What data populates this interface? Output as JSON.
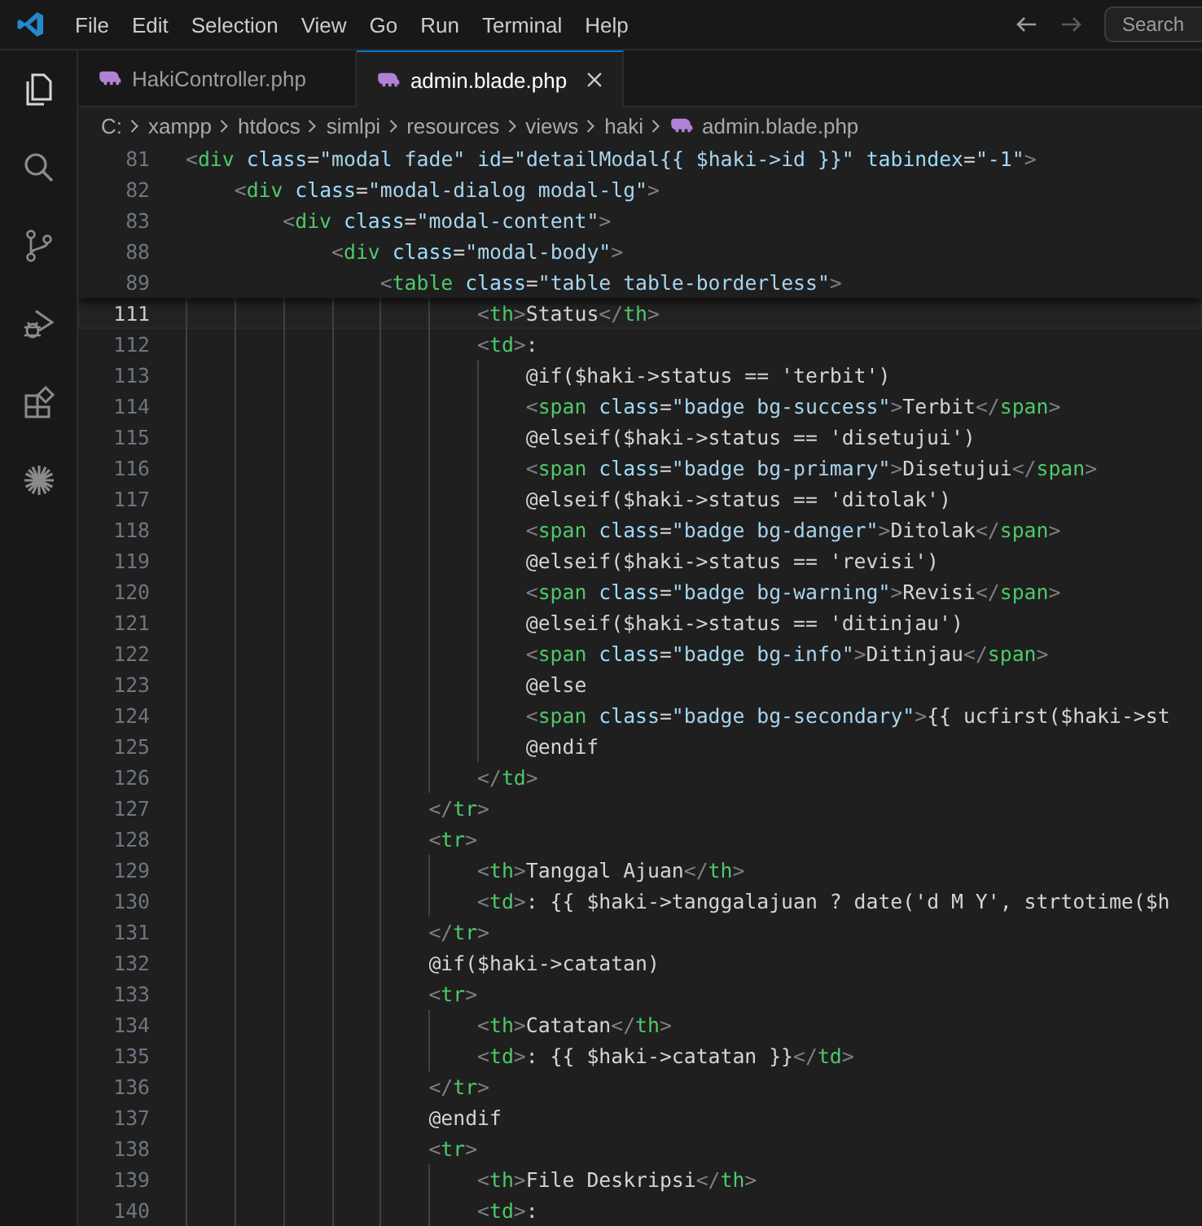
{
  "menu": [
    "File",
    "Edit",
    "Selection",
    "View",
    "Go",
    "Run",
    "Terminal",
    "Help"
  ],
  "search": {
    "placeholder": "Search"
  },
  "activity_bar": [
    {
      "kind": "explorer",
      "selected": true
    },
    {
      "kind": "search",
      "selected": false
    },
    {
      "kind": "source-control",
      "selected": false
    },
    {
      "kind": "run-debug",
      "selected": false
    },
    {
      "kind": "extensions",
      "selected": false
    },
    {
      "kind": "burst",
      "selected": false
    }
  ],
  "tabs": [
    {
      "label": "HakiController.php",
      "selected": false
    },
    {
      "label": "admin.blade.php",
      "selected": true
    }
  ],
  "breadcrumb": [
    "C:",
    "xampp",
    "htdocs",
    "simlpi",
    "resources",
    "views",
    "haki",
    "admin.blade.php"
  ],
  "sticky_lines": [
    {
      "number": "81",
      "tokens": [
        {
          "kind": "punct",
          "text": "<"
        },
        {
          "kind": "tag",
          "text": "div"
        },
        {
          "kind": "attr",
          "text": " class"
        },
        {
          "kind": "plain",
          "text": "="
        },
        {
          "kind": "string",
          "text": "\"modal fade\""
        },
        {
          "kind": "attr",
          "text": " id"
        },
        {
          "kind": "plain",
          "text": "="
        },
        {
          "kind": "string",
          "text": "\"detailModal{{ $haki->id }}\""
        },
        {
          "kind": "attr",
          "text": " tabindex"
        },
        {
          "kind": "plain",
          "text": "="
        },
        {
          "kind": "string",
          "text": "\"-1\""
        },
        {
          "kind": "punct",
          "text": ">"
        }
      ]
    },
    {
      "number": "82",
      "tokens": [
        {
          "kind": "punct",
          "text": "    <"
        },
        {
          "kind": "tag",
          "text": "div"
        },
        {
          "kind": "attr",
          "text": " class"
        },
        {
          "kind": "plain",
          "text": "="
        },
        {
          "kind": "string",
          "text": "\"modal-dialog modal-lg\""
        },
        {
          "kind": "punct",
          "text": ">"
        }
      ]
    },
    {
      "number": "83",
      "tokens": [
        {
          "kind": "punct",
          "text": "        <"
        },
        {
          "kind": "tag",
          "text": "div"
        },
        {
          "kind": "attr",
          "text": " class"
        },
        {
          "kind": "plain",
          "text": "="
        },
        {
          "kind": "string",
          "text": "\"modal-content\""
        },
        {
          "kind": "punct",
          "text": ">"
        }
      ]
    },
    {
      "number": "88",
      "tokens": [
        {
          "kind": "punct",
          "text": "            <"
        },
        {
          "kind": "tag",
          "text": "div"
        },
        {
          "kind": "attr",
          "text": " class"
        },
        {
          "kind": "plain",
          "text": "="
        },
        {
          "kind": "string",
          "text": "\"modal-body\""
        },
        {
          "kind": "punct",
          "text": ">"
        }
      ]
    },
    {
      "number": "89",
      "tokens": [
        {
          "kind": "punct",
          "text": "                <"
        },
        {
          "kind": "tag",
          "text": "table"
        },
        {
          "kind": "attr",
          "text": " class"
        },
        {
          "kind": "plain",
          "text": "="
        },
        {
          "kind": "string",
          "text": "\"table table-borderless\""
        },
        {
          "kind": "punct",
          "text": ">"
        }
      ]
    }
  ],
  "lines": [
    {
      "number": "111",
      "selected": true,
      "tokens": [
        {
          "kind": "punct",
          "text": "                        <"
        },
        {
          "kind": "tag",
          "text": "th"
        },
        {
          "kind": "punct",
          "text": ">"
        },
        {
          "kind": "plain",
          "text": "Status"
        },
        {
          "kind": "punct",
          "text": "</"
        },
        {
          "kind": "tag",
          "text": "th"
        },
        {
          "kind": "punct",
          "text": ">"
        }
      ]
    },
    {
      "number": "112",
      "selected": false,
      "tokens": [
        {
          "kind": "punct",
          "text": "                        <"
        },
        {
          "kind": "tag",
          "text": "td"
        },
        {
          "kind": "punct",
          "text": ">"
        },
        {
          "kind": "plain",
          "text": ":"
        }
      ]
    },
    {
      "number": "113",
      "selected": false,
      "tokens": [
        {
          "kind": "plain",
          "text": "                            @if($haki->status == 'terbit')"
        }
      ]
    },
    {
      "number": "114",
      "selected": false,
      "tokens": [
        {
          "kind": "punct",
          "text": "                            <"
        },
        {
          "kind": "tag",
          "text": "span"
        },
        {
          "kind": "attr",
          "text": " class"
        },
        {
          "kind": "plain",
          "text": "="
        },
        {
          "kind": "string",
          "text": "\"badge bg-success\""
        },
        {
          "kind": "punct",
          "text": ">"
        },
        {
          "kind": "plain",
          "text": "Terbit"
        },
        {
          "kind": "punct",
          "text": "</"
        },
        {
          "kind": "tag",
          "text": "span"
        },
        {
          "kind": "punct",
          "text": ">"
        }
      ]
    },
    {
      "number": "115",
      "selected": false,
      "tokens": [
        {
          "kind": "plain",
          "text": "                            @elseif($haki->status == 'disetujui')"
        }
      ]
    },
    {
      "number": "116",
      "selected": false,
      "tokens": [
        {
          "kind": "punct",
          "text": "                            <"
        },
        {
          "kind": "tag",
          "text": "span"
        },
        {
          "kind": "attr",
          "text": " class"
        },
        {
          "kind": "plain",
          "text": "="
        },
        {
          "kind": "string",
          "text": "\"badge bg-primary\""
        },
        {
          "kind": "punct",
          "text": ">"
        },
        {
          "kind": "plain",
          "text": "Disetujui"
        },
        {
          "kind": "punct",
          "text": "</"
        },
        {
          "kind": "tag",
          "text": "span"
        },
        {
          "kind": "punct",
          "text": ">"
        }
      ]
    },
    {
      "number": "117",
      "selected": false,
      "tokens": [
        {
          "kind": "plain",
          "text": "                            @elseif($haki->status == 'ditolak')"
        }
      ]
    },
    {
      "number": "118",
      "selected": false,
      "tokens": [
        {
          "kind": "punct",
          "text": "                            <"
        },
        {
          "kind": "tag",
          "text": "span"
        },
        {
          "kind": "attr",
          "text": " class"
        },
        {
          "kind": "plain",
          "text": "="
        },
        {
          "kind": "string",
          "text": "\"badge bg-danger\""
        },
        {
          "kind": "punct",
          "text": ">"
        },
        {
          "kind": "plain",
          "text": "Ditolak"
        },
        {
          "kind": "punct",
          "text": "</"
        },
        {
          "kind": "tag",
          "text": "span"
        },
        {
          "kind": "punct",
          "text": ">"
        }
      ]
    },
    {
      "number": "119",
      "selected": false,
      "tokens": [
        {
          "kind": "plain",
          "text": "                            @elseif($haki->status == 'revisi')"
        }
      ]
    },
    {
      "number": "120",
      "selected": false,
      "tokens": [
        {
          "kind": "punct",
          "text": "                            <"
        },
        {
          "kind": "tag",
          "text": "span"
        },
        {
          "kind": "attr",
          "text": " class"
        },
        {
          "kind": "plain",
          "text": "="
        },
        {
          "kind": "string",
          "text": "\"badge bg-warning\""
        },
        {
          "kind": "punct",
          "text": ">"
        },
        {
          "kind": "plain",
          "text": "Revisi"
        },
        {
          "kind": "punct",
          "text": "</"
        },
        {
          "kind": "tag",
          "text": "span"
        },
        {
          "kind": "punct",
          "text": ">"
        }
      ]
    },
    {
      "number": "121",
      "selected": false,
      "tokens": [
        {
          "kind": "plain",
          "text": "                            @elseif($haki->status == 'ditinjau')"
        }
      ]
    },
    {
      "number": "122",
      "selected": false,
      "tokens": [
        {
          "kind": "punct",
          "text": "                            <"
        },
        {
          "kind": "tag",
          "text": "span"
        },
        {
          "kind": "attr",
          "text": " class"
        },
        {
          "kind": "plain",
          "text": "="
        },
        {
          "kind": "string",
          "text": "\"badge bg-info\""
        },
        {
          "kind": "punct",
          "text": ">"
        },
        {
          "kind": "plain",
          "text": "Ditinjau"
        },
        {
          "kind": "punct",
          "text": "</"
        },
        {
          "kind": "tag",
          "text": "span"
        },
        {
          "kind": "punct",
          "text": ">"
        }
      ]
    },
    {
      "number": "123",
      "selected": false,
      "tokens": [
        {
          "kind": "plain",
          "text": "                            @else"
        }
      ]
    },
    {
      "number": "124",
      "selected": false,
      "tokens": [
        {
          "kind": "punct",
          "text": "                            <"
        },
        {
          "kind": "tag",
          "text": "span"
        },
        {
          "kind": "attr",
          "text": " class"
        },
        {
          "kind": "plain",
          "text": "="
        },
        {
          "kind": "string",
          "text": "\"badge bg-secondary\""
        },
        {
          "kind": "punct",
          "text": ">"
        },
        {
          "kind": "plain",
          "text": "{{ ucfirst($haki->st"
        }
      ]
    },
    {
      "number": "125",
      "selected": false,
      "tokens": [
        {
          "kind": "plain",
          "text": "                            @endif"
        }
      ]
    },
    {
      "number": "126",
      "selected": false,
      "tokens": [
        {
          "kind": "punct",
          "text": "                        </"
        },
        {
          "kind": "tag",
          "text": "td"
        },
        {
          "kind": "punct",
          "text": ">"
        }
      ]
    },
    {
      "number": "127",
      "selected": false,
      "tokens": [
        {
          "kind": "punct",
          "text": "                    </"
        },
        {
          "kind": "tag",
          "text": "tr"
        },
        {
          "kind": "punct",
          "text": ">"
        }
      ]
    },
    {
      "number": "128",
      "selected": false,
      "tokens": [
        {
          "kind": "punct",
          "text": "                    <"
        },
        {
          "kind": "tag",
          "text": "tr"
        },
        {
          "kind": "punct",
          "text": ">"
        }
      ]
    },
    {
      "number": "129",
      "selected": false,
      "tokens": [
        {
          "kind": "punct",
          "text": "                        <"
        },
        {
          "kind": "tag",
          "text": "th"
        },
        {
          "kind": "punct",
          "text": ">"
        },
        {
          "kind": "plain",
          "text": "Tanggal Ajuan"
        },
        {
          "kind": "punct",
          "text": "</"
        },
        {
          "kind": "tag",
          "text": "th"
        },
        {
          "kind": "punct",
          "text": ">"
        }
      ]
    },
    {
      "number": "130",
      "selected": false,
      "tokens": [
        {
          "kind": "punct",
          "text": "                        <"
        },
        {
          "kind": "tag",
          "text": "td"
        },
        {
          "kind": "punct",
          "text": ">"
        },
        {
          "kind": "plain",
          "text": ": {{ $haki->tanggalajuan ? date('d M Y', strtotime($h"
        }
      ]
    },
    {
      "number": "131",
      "selected": false,
      "tokens": [
        {
          "kind": "punct",
          "text": "                    </"
        },
        {
          "kind": "tag",
          "text": "tr"
        },
        {
          "kind": "punct",
          "text": ">"
        }
      ]
    },
    {
      "number": "132",
      "selected": false,
      "tokens": [
        {
          "kind": "plain",
          "text": "                    @if($haki->catatan)"
        }
      ]
    },
    {
      "number": "133",
      "selected": false,
      "tokens": [
        {
          "kind": "punct",
          "text": "                    <"
        },
        {
          "kind": "tag",
          "text": "tr"
        },
        {
          "kind": "punct",
          "text": ">"
        }
      ]
    },
    {
      "number": "134",
      "selected": false,
      "tokens": [
        {
          "kind": "punct",
          "text": "                        <"
        },
        {
          "kind": "tag",
          "text": "th"
        },
        {
          "kind": "punct",
          "text": ">"
        },
        {
          "kind": "plain",
          "text": "Catatan"
        },
        {
          "kind": "punct",
          "text": "</"
        },
        {
          "kind": "tag",
          "text": "th"
        },
        {
          "kind": "punct",
          "text": ">"
        }
      ]
    },
    {
      "number": "135",
      "selected": false,
      "tokens": [
        {
          "kind": "punct",
          "text": "                        <"
        },
        {
          "kind": "tag",
          "text": "td"
        },
        {
          "kind": "punct",
          "text": ">"
        },
        {
          "kind": "plain",
          "text": ": {{ $haki->catatan }}"
        },
        {
          "kind": "punct",
          "text": "</"
        },
        {
          "kind": "tag",
          "text": "td"
        },
        {
          "kind": "punct",
          "text": ">"
        }
      ]
    },
    {
      "number": "136",
      "selected": false,
      "tokens": [
        {
          "kind": "punct",
          "text": "                    </"
        },
        {
          "kind": "tag",
          "text": "tr"
        },
        {
          "kind": "punct",
          "text": ">"
        }
      ]
    },
    {
      "number": "137",
      "selected": false,
      "tokens": [
        {
          "kind": "plain",
          "text": "                    @endif"
        }
      ]
    },
    {
      "number": "138",
      "selected": false,
      "tokens": [
        {
          "kind": "punct",
          "text": "                    <"
        },
        {
          "kind": "tag",
          "text": "tr"
        },
        {
          "kind": "punct",
          "text": ">"
        }
      ]
    },
    {
      "number": "139",
      "selected": false,
      "tokens": [
        {
          "kind": "punct",
          "text": "                        <"
        },
        {
          "kind": "tag",
          "text": "th"
        },
        {
          "kind": "punct",
          "text": ">"
        },
        {
          "kind": "plain",
          "text": "File Deskripsi"
        },
        {
          "kind": "punct",
          "text": "</"
        },
        {
          "kind": "tag",
          "text": "th"
        },
        {
          "kind": "punct",
          "text": ">"
        }
      ]
    },
    {
      "number": "140",
      "selected": false,
      "tokens": [
        {
          "kind": "punct",
          "text": "                        <"
        },
        {
          "kind": "tag",
          "text": "td"
        },
        {
          "kind": "punct",
          "text": ">"
        },
        {
          "kind": "plain",
          "text": ":"
        }
      ]
    }
  ]
}
